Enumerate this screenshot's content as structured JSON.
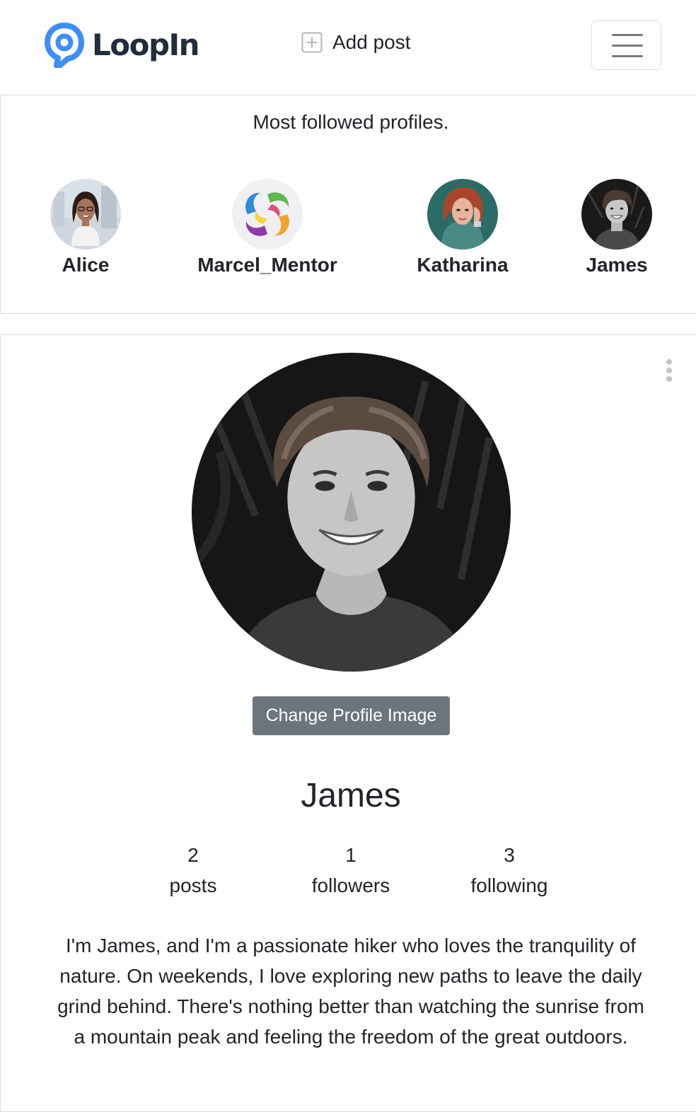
{
  "brand": {
    "name": "LoopIn",
    "color": "#3d8ef7"
  },
  "nav": {
    "add_post_label": "Add post"
  },
  "most_followed": {
    "heading": "Most followed profiles.",
    "profiles": [
      {
        "name": "Alice",
        "avatar": "alice-photo"
      },
      {
        "name": "Marcel_Mentor",
        "avatar": "swirl-logo"
      },
      {
        "name": "Katharina",
        "avatar": "katharina-photo"
      },
      {
        "name": "James",
        "avatar": "james-photo"
      }
    ]
  },
  "profile": {
    "name": "James",
    "change_image_label": "Change Profile Image",
    "stats": {
      "posts": {
        "value": "2",
        "label": "posts"
      },
      "followers": {
        "value": "1",
        "label": "followers"
      },
      "following": {
        "value": "3",
        "label": "following"
      }
    },
    "bio": "I'm James, and I'm a passionate hiker who loves the tranquility of nature. On weekends, I love exploring new paths to leave the daily grind behind. There's nothing better than watching the sunrise from a mountain peak and feeling the freedom of the great outdoors."
  },
  "colors": {
    "button_bg": "#6c757d",
    "border": "#dcdcdc",
    "text": "#212529"
  }
}
